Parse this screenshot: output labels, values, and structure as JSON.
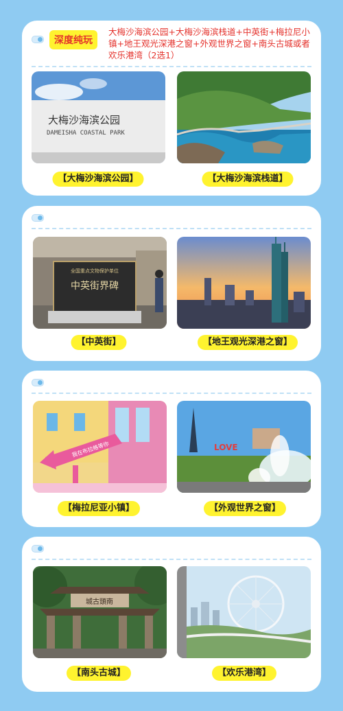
{
  "header": {
    "badge": "深度纯玩",
    "route": "大梅沙海滨公园+大梅沙海滨栈道+中英街+梅拉尼小镇+地王观光深港之窗+外观世界之窗+南头古城或者欢乐港湾（2选1）"
  },
  "sections": [
    {
      "items": [
        {
          "label": "【大梅沙海滨公园】",
          "sign_text": "大梅沙海滨公园",
          "sign_sub": "DAMEISHA COASTAL PARK"
        },
        {
          "label": "【大梅沙海滨栈道】"
        }
      ]
    },
    {
      "items": [
        {
          "label": "【中英街】",
          "plaque_small": "全国重点文物保护单位",
          "plaque_title": "中英街界碑"
        },
        {
          "label": "【地王观光深港之窗】"
        }
      ]
    },
    {
      "items": [
        {
          "label": "【梅拉尼亚小镇】",
          "sign_text": "我在布拉格等你"
        },
        {
          "label": "【外观世界之窗】",
          "sign_text": "LOVE"
        }
      ]
    },
    {
      "items": [
        {
          "label": "【南头古城】",
          "gate_text": "城古頭南"
        },
        {
          "label": "【欢乐港湾】"
        }
      ]
    }
  ]
}
